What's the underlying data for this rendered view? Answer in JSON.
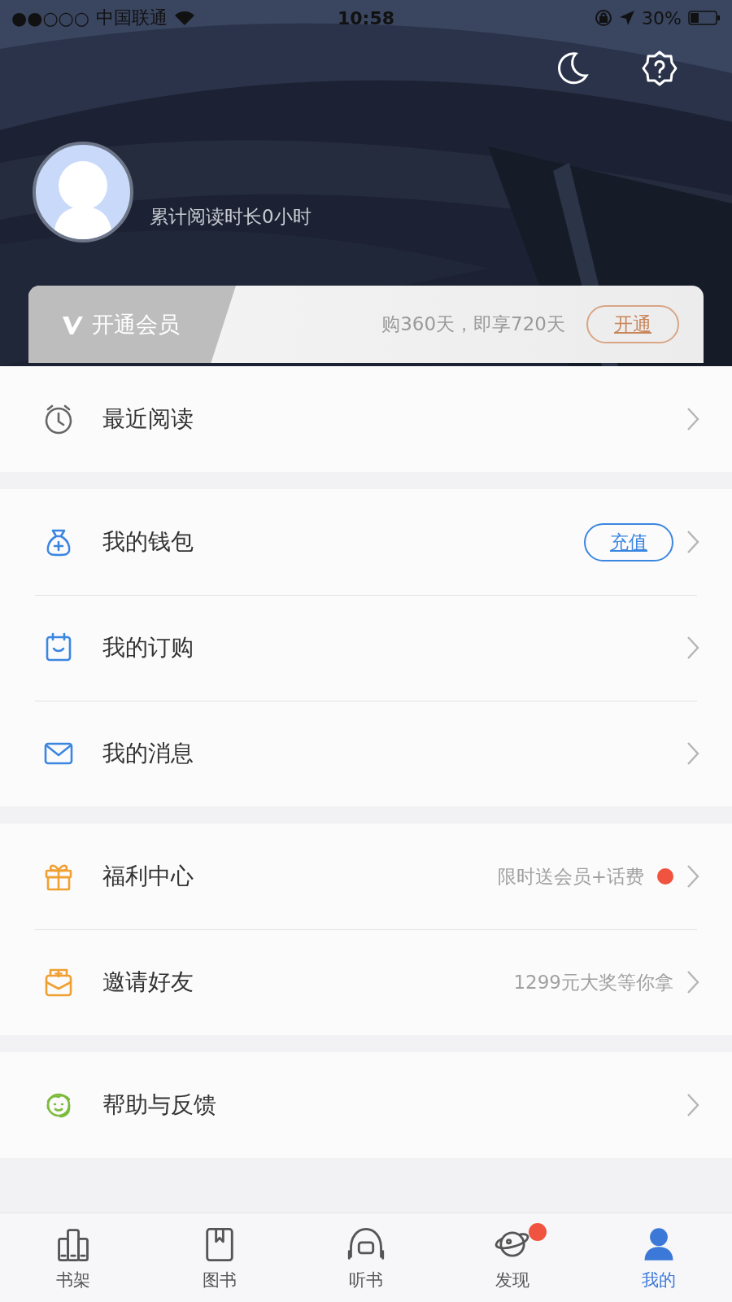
{
  "status_bar": {
    "signal": "●●○○○",
    "carrier": "中国联通",
    "time": "10:58",
    "battery": "30%"
  },
  "header": {
    "reading_time": "累计阅读时长0小时"
  },
  "vip_banner": {
    "title": "开通会员",
    "promo": "购360天，即享720天",
    "button": "开通"
  },
  "sections": [
    {
      "items": [
        {
          "kind": "clock",
          "label": "最近阅读"
        }
      ]
    },
    {
      "items": [
        {
          "kind": "wallet",
          "label": "我的钱包",
          "action_button": "充值"
        },
        {
          "kind": "subscription",
          "label": "我的订购"
        },
        {
          "kind": "mail",
          "label": "我的消息"
        }
      ]
    },
    {
      "items": [
        {
          "kind": "gift",
          "label": "福利中心",
          "hint": "限时送会员+话费",
          "color": "#f0533f"
        },
        {
          "kind": "invite",
          "label": "邀请好友",
          "hint": "1299元大奖等你拿"
        }
      ]
    },
    {
      "items": [
        {
          "kind": "support",
          "label": "帮助与反馈"
        }
      ]
    }
  ],
  "tab_bar": [
    {
      "kind": "shelf",
      "label": "书架",
      "selected": false,
      "badge": false
    },
    {
      "kind": "book",
      "label": "图书",
      "selected": false,
      "badge": false
    },
    {
      "kind": "audio",
      "label": "听书",
      "selected": false,
      "badge": false
    },
    {
      "kind": "planet",
      "label": "发现",
      "selected": false,
      "badge": true
    },
    {
      "kind": "me",
      "label": "我的",
      "selected": true,
      "badge": false
    }
  ]
}
